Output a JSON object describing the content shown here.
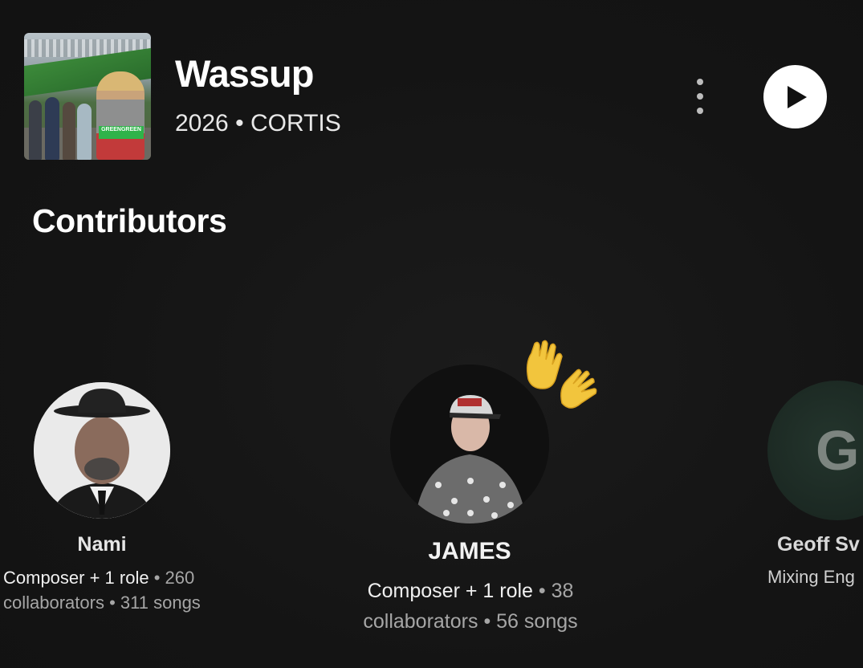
{
  "album": {
    "title": "Wassup",
    "year": "2026",
    "separator": "•",
    "artist": "CORTIS",
    "cover_tag": "GREENGREEN",
    "more_icon": "more-vertical-icon",
    "play_icon": "play-icon"
  },
  "section": {
    "title": "Contributors"
  },
  "contributors": [
    {
      "name": "Nami",
      "role": "Composer + 1 role",
      "collaborators": "260",
      "collaborators_label": "collaborators",
      "songs": "311 songs"
    },
    {
      "name": "JAMES",
      "role": "Composer + 1 role",
      "collaborators": "38",
      "collaborators_label": "collaborators",
      "songs": "56 songs",
      "badge_icon": "waving-hands-icon"
    },
    {
      "name": "Geoff Sv",
      "role": "Mixing Eng",
      "initial": "G"
    }
  ],
  "colors": {
    "background": "#141414",
    "text_primary": "#ffffff",
    "text_secondary": "#a6a6a6",
    "play_button": "#ffffff"
  }
}
